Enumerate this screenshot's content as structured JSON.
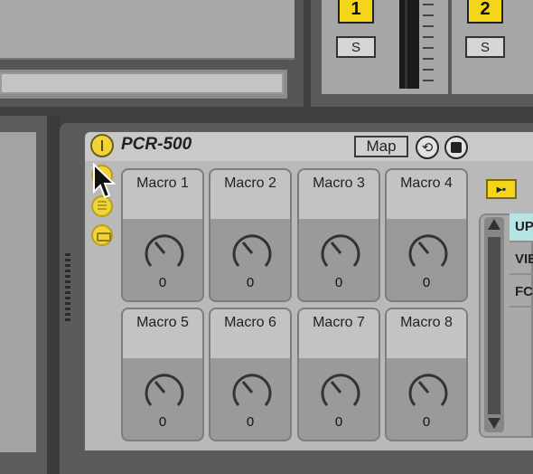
{
  "mixer": {
    "tracks": [
      {
        "number": "1",
        "solo_label": "S"
      },
      {
        "number": "2",
        "solo_label": "S"
      }
    ]
  },
  "device": {
    "title": "PCR-500",
    "map_label": "Map",
    "hot_swap_glyph": "⟲",
    "mapping_button_glyph": "▸▪",
    "macros": [
      {
        "label": "Macro 1",
        "value": "0"
      },
      {
        "label": "Macro 2",
        "value": "0"
      },
      {
        "label": "Macro 3",
        "value": "0"
      },
      {
        "label": "Macro 4",
        "value": "0"
      },
      {
        "label": "Macro 5",
        "value": "0"
      },
      {
        "label": "Macro 6",
        "value": "0"
      },
      {
        "label": "Macro 7",
        "value": "0"
      },
      {
        "label": "Macro 8",
        "value": "0"
      }
    ],
    "list_items": [
      "UP",
      "VIE",
      "FC"
    ]
  },
  "colors": {
    "accent": "#f3d51a",
    "panel": "#b9b9b9",
    "selected": "#b7e3e2"
  }
}
